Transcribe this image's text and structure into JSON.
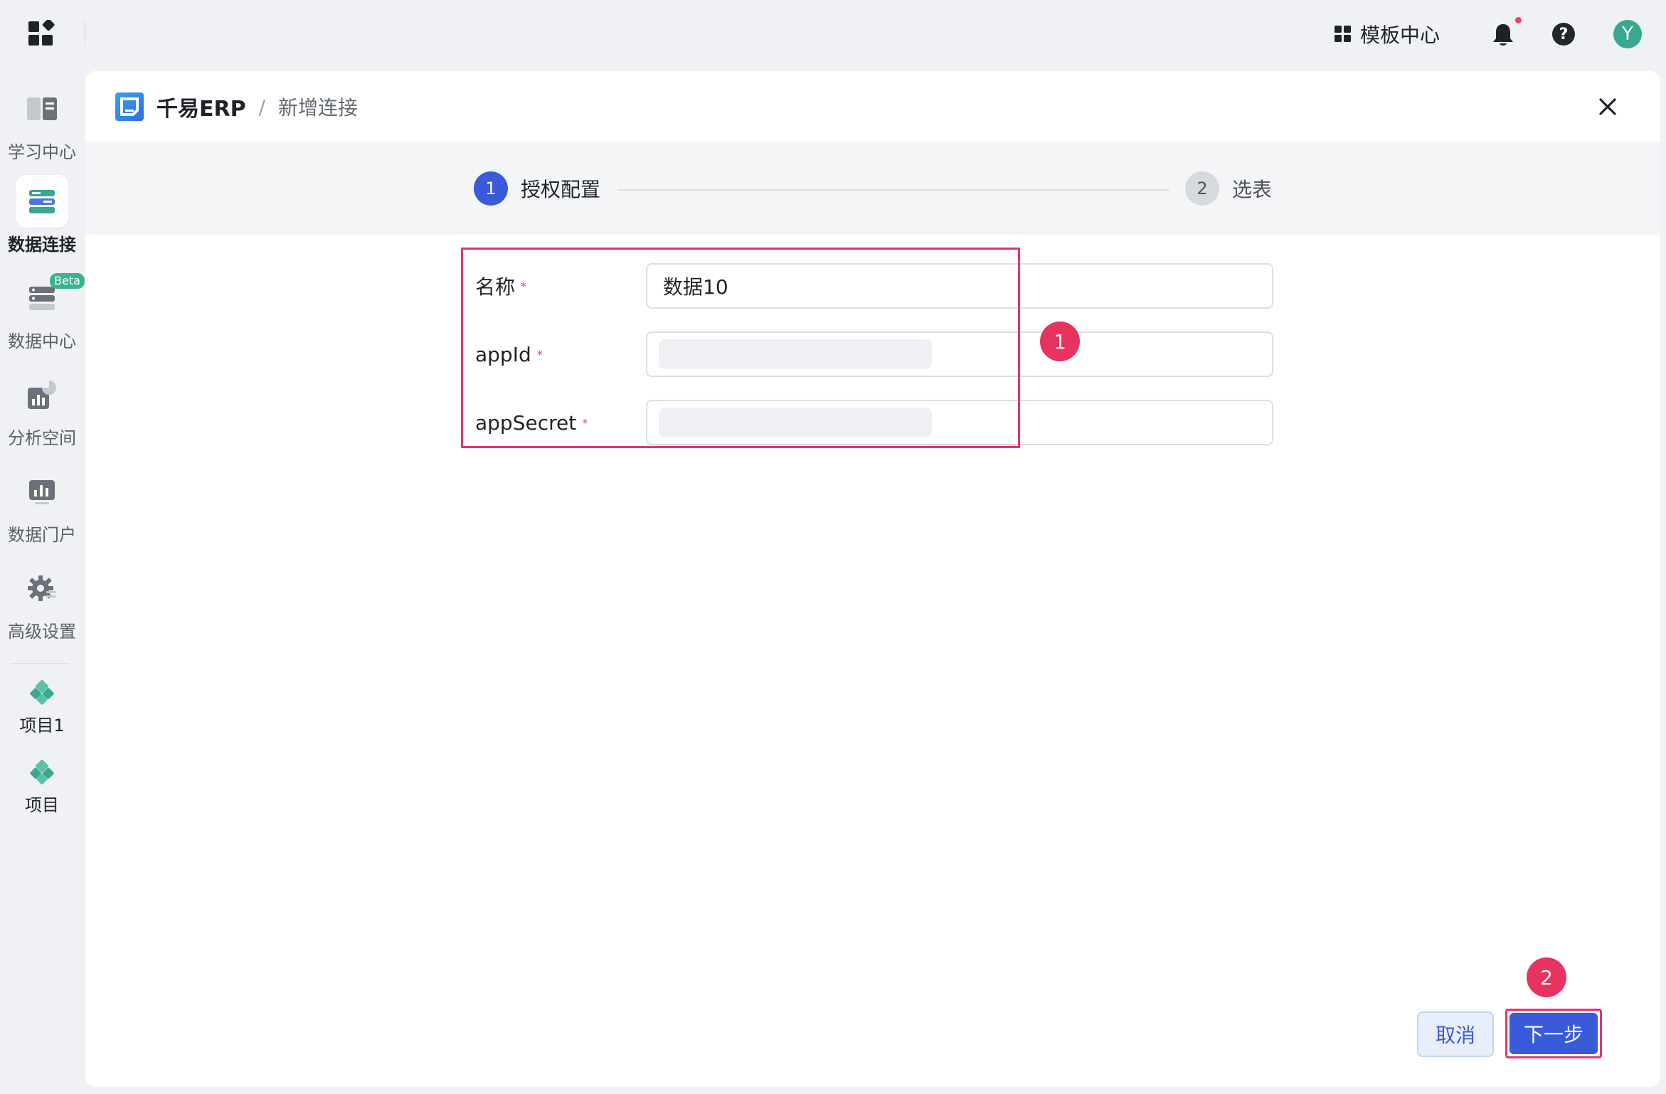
{
  "topbar": {
    "template_center_label": "模板中心",
    "avatar_letter": "Y",
    "help_symbol": "?"
  },
  "sidebar": {
    "items": [
      {
        "label": "学习中心",
        "icon": "book-icon"
      },
      {
        "label": "数据连接",
        "icon": "data-connect-icon",
        "active": true
      },
      {
        "label": "数据中心",
        "icon": "database-icon",
        "badge": "Beta"
      },
      {
        "label": "分析空间",
        "icon": "chart-pie-icon"
      },
      {
        "label": "数据门户",
        "icon": "dashboard-icon"
      },
      {
        "label": "高级设置",
        "icon": "gear-icon"
      }
    ],
    "projects": [
      {
        "label": "项目1",
        "icon": "project-icon"
      },
      {
        "label": "项目",
        "icon": "project-icon"
      }
    ]
  },
  "header": {
    "app_name": "千易ERP",
    "separator": "/",
    "page_title": "新增连接"
  },
  "steps": [
    {
      "number": "1",
      "label": "授权配置",
      "state": "active"
    },
    {
      "number": "2",
      "label": "选表",
      "state": "pending"
    }
  ],
  "form": {
    "fields": [
      {
        "label": "名称",
        "required_mark": "*",
        "value": "数据10"
      },
      {
        "label": "appId",
        "required_mark": "*",
        "value": ""
      },
      {
        "label": "appSecret",
        "required_mark": "*",
        "value": ""
      }
    ]
  },
  "annotations": {
    "marker_1": "1",
    "marker_2": "2"
  },
  "footer": {
    "cancel_label": "取消",
    "next_label": "下一步"
  },
  "colors": {
    "primary": "#3a5bd9",
    "highlight": "#e0376b",
    "accent_green": "#35b48f",
    "required": "#e0405a"
  }
}
